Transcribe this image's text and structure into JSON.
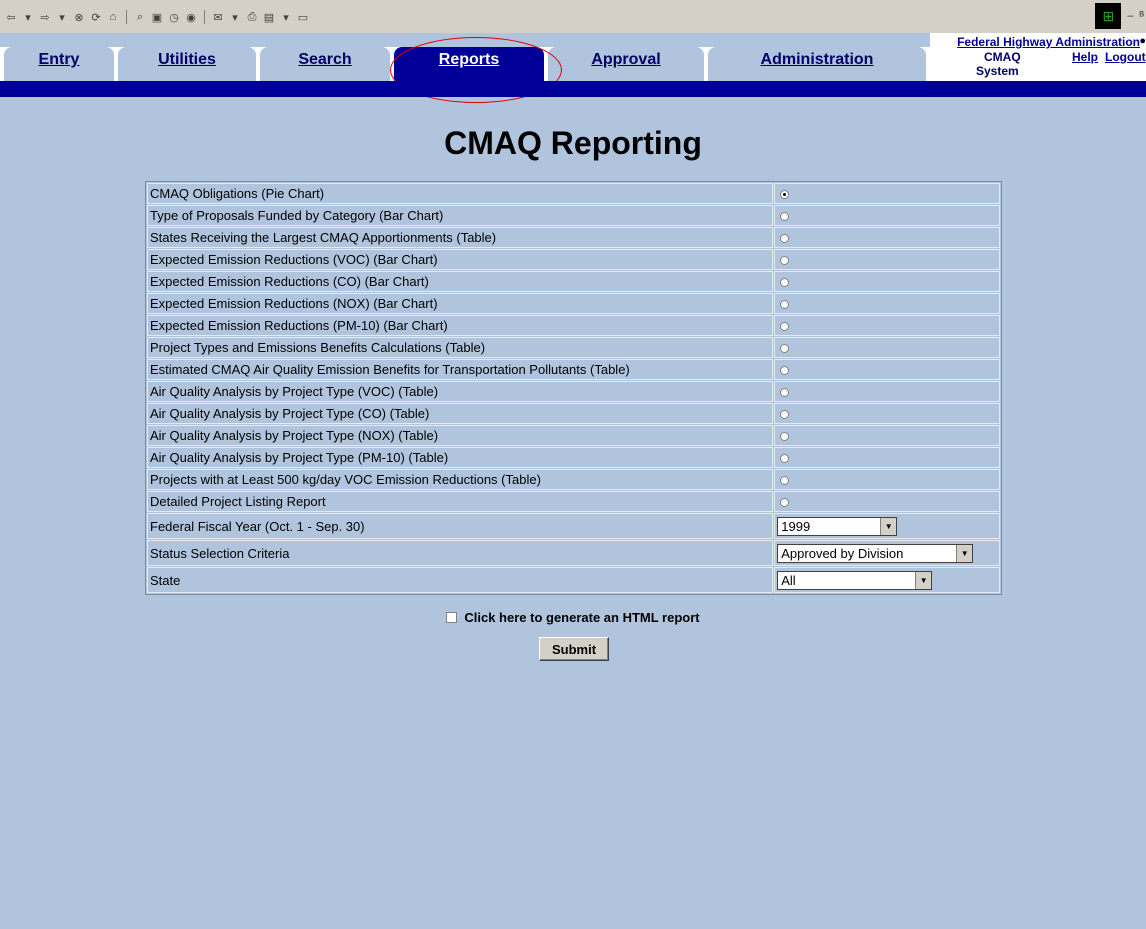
{
  "browser": {
    "toolbar_icons": [
      "back-icon",
      "forward-icon",
      "stop-icon",
      "refresh-icon",
      "home-icon",
      "search-icon",
      "favorites-icon",
      "history-icon",
      "mail-icon",
      "print-icon",
      "edit-icon",
      "discuss-icon"
    ]
  },
  "nav": {
    "tabs": [
      {
        "label": "Entry"
      },
      {
        "label": "Utilities"
      },
      {
        "label": "Search"
      },
      {
        "label": "Reports"
      },
      {
        "label": "Approval"
      },
      {
        "label": "Administration"
      }
    ],
    "active_tab": "Reports",
    "agency_link": "Federal Highway Administration",
    "system_name_line1": "CMAQ",
    "system_name_line2": "System",
    "help_label": "Help",
    "logout_label": "Logout"
  },
  "page": {
    "title": "CMAQ Reporting"
  },
  "reports": [
    {
      "label": "CMAQ Obligations (Pie Chart)",
      "selected": true
    },
    {
      "label": "Type of Proposals Funded by Category (Bar Chart)",
      "selected": false
    },
    {
      "label": "States Receiving the Largest CMAQ Apportionments (Table)",
      "selected": false
    },
    {
      "label": "Expected Emission Reductions (VOC) (Bar Chart)",
      "selected": false
    },
    {
      "label": "Expected Emission Reductions (CO) (Bar Chart)",
      "selected": false
    },
    {
      "label": "Expected Emission Reductions (NOX) (Bar Chart)",
      "selected": false
    },
    {
      "label": "Expected Emission Reductions (PM-10) (Bar Chart)",
      "selected": false
    },
    {
      "label": "Project Types and Emissions Benefits Calculations (Table)",
      "selected": false
    },
    {
      "label": "Estimated CMAQ Air Quality Emission Benefits for Transportation Pollutants (Table)",
      "selected": false
    },
    {
      "label": "Air Quality Analysis by Project Type (VOC) (Table)",
      "selected": false
    },
    {
      "label": "Air Quality Analysis by Project Type (CO) (Table)",
      "selected": false
    },
    {
      "label": "Air Quality Analysis by Project Type (NOX) (Table)",
      "selected": false
    },
    {
      "label": "Air Quality Analysis by Project Type (PM-10) (Table)",
      "selected": false
    },
    {
      "label": "Projects with at Least 500 kg/day VOC Emission Reductions (Table)",
      "selected": false
    },
    {
      "label": "Detailed Project Listing Report",
      "selected": false
    }
  ],
  "filters": {
    "fiscal_year_label": "Federal Fiscal Year (Oct. 1 - Sep. 30)",
    "fiscal_year_value": "1999",
    "status_label": "Status Selection Criteria",
    "status_value": "Approved by Division",
    "state_label": "State",
    "state_value": "All"
  },
  "html_report_label": "Click here to generate an HTML report",
  "submit_label": "Submit",
  "colors": {
    "page_bg": "#b0c4de",
    "nav_active": "#000099",
    "link": "#000099",
    "highlight_circle": "#e00000"
  }
}
